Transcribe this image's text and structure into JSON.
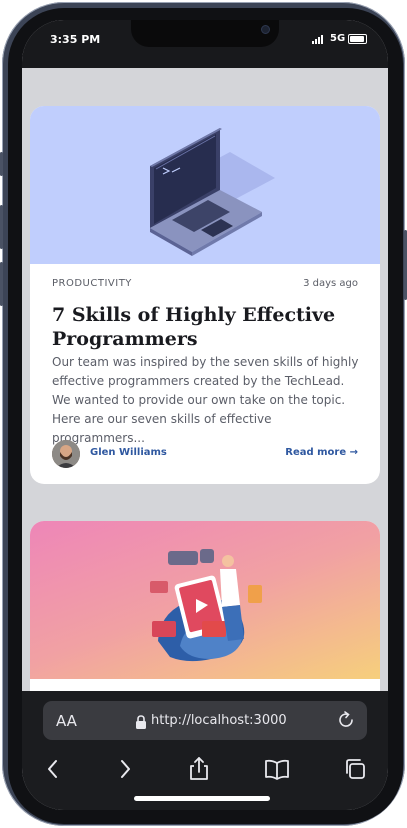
{
  "status_bar": {
    "time": "3:35 PM",
    "network": "5G",
    "icons": [
      "signal-icon",
      "battery-icon"
    ]
  },
  "articles": [
    {
      "image": "laptop-illustration",
      "image_bg": "#c0cefd",
      "category": "PRODUCTIVITY",
      "age": "3 days ago",
      "title": "7 Skills of Highly Effective Programmers",
      "excerpt": "Our team was inspired by the seven skills of highly effective programmers created by the TechLead. We wanted to provide our own take on the topic. Here are our seven skills of effective programmers...",
      "author": "Glen Williams",
      "read_more": "Read more →"
    },
    {
      "image": "social-media-illustration",
      "image_bg": "#ee86b8"
    }
  ],
  "browser": {
    "text_size_label": "AA",
    "url": "http://localhost:3000",
    "toolbar": [
      "back-icon",
      "forward-icon",
      "share-icon",
      "bookmarks-icon",
      "tabs-icon"
    ]
  },
  "colors": {
    "link": "#2f58a0",
    "page_bg": "#d4d5d9",
    "title": "#191a1f"
  }
}
